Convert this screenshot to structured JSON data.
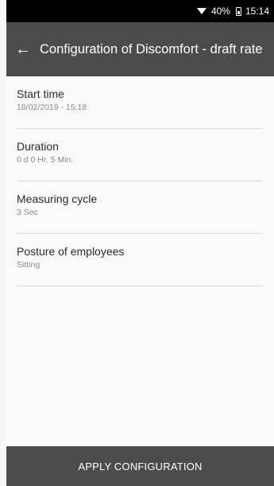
{
  "status": {
    "battery": "40%",
    "time": "15:14"
  },
  "header": {
    "title": "Configuration of Discomfort - draft rate"
  },
  "settings": [
    {
      "label": "Start time",
      "value": "18/02/2019 - 15:18"
    },
    {
      "label": "Duration",
      "value": "0 d 0 Hr. 5 Min."
    },
    {
      "label": "Measuring cycle",
      "value": "3 Sec"
    },
    {
      "label": "Posture of employees",
      "value": "Sitting"
    }
  ],
  "footer": {
    "apply_label": "APPLY CONFIGURATION"
  },
  "icons": {
    "back": "arrow-left-icon",
    "wifi": "wifi-icon",
    "battery": "battery-icon"
  }
}
